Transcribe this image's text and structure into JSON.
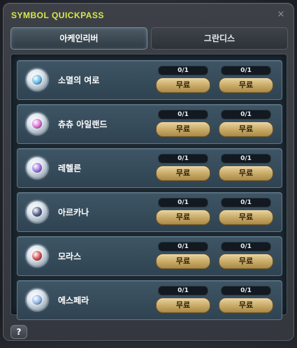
{
  "window": {
    "title": "SYMBOL QUICKPASS",
    "close_label": "×"
  },
  "tabs": [
    {
      "label": "아케인리버",
      "active": true
    },
    {
      "label": "그란디스",
      "active": false
    }
  ],
  "rows": [
    {
      "name": "소멸의 여로",
      "icon": "vanishing-journey-symbol-icon",
      "gem_color": "#5fb7e6",
      "slots": [
        {
          "count": "0/1",
          "button": "무료"
        },
        {
          "count": "0/1",
          "button": "무료"
        }
      ]
    },
    {
      "name": "츄츄 아일랜드",
      "icon": "chuchu-island-symbol-icon",
      "gem_color": "#d86ad0",
      "slots": [
        {
          "count": "0/1",
          "button": "무료"
        },
        {
          "count": "0/1",
          "button": "무료"
        }
      ]
    },
    {
      "name": "레헬른",
      "icon": "lachelein-symbol-icon",
      "gem_color": "#9a6ee0",
      "slots": [
        {
          "count": "0/1",
          "button": "무료"
        },
        {
          "count": "0/1",
          "button": "무료"
        }
      ]
    },
    {
      "name": "아르카나",
      "icon": "arcana-symbol-icon",
      "gem_color": "#4f5a82",
      "slots": [
        {
          "count": "0/1",
          "button": "무료"
        },
        {
          "count": "0/1",
          "button": "무료"
        }
      ]
    },
    {
      "name": "모라스",
      "icon": "morass-symbol-icon",
      "gem_color": "#d24a4a",
      "slots": [
        {
          "count": "0/1",
          "button": "무료"
        },
        {
          "count": "0/1",
          "button": "무료"
        }
      ]
    },
    {
      "name": "에스페라",
      "icon": "esfera-symbol-icon",
      "gem_color": "#8cb6e6",
      "slots": [
        {
          "count": "0/1",
          "button": "무료"
        },
        {
          "count": "0/1",
          "button": "무료"
        }
      ]
    }
  ],
  "help_label": "?",
  "colors": {
    "title": "#d9e84a",
    "button": "#c7a865",
    "row": "#3e5565"
  }
}
